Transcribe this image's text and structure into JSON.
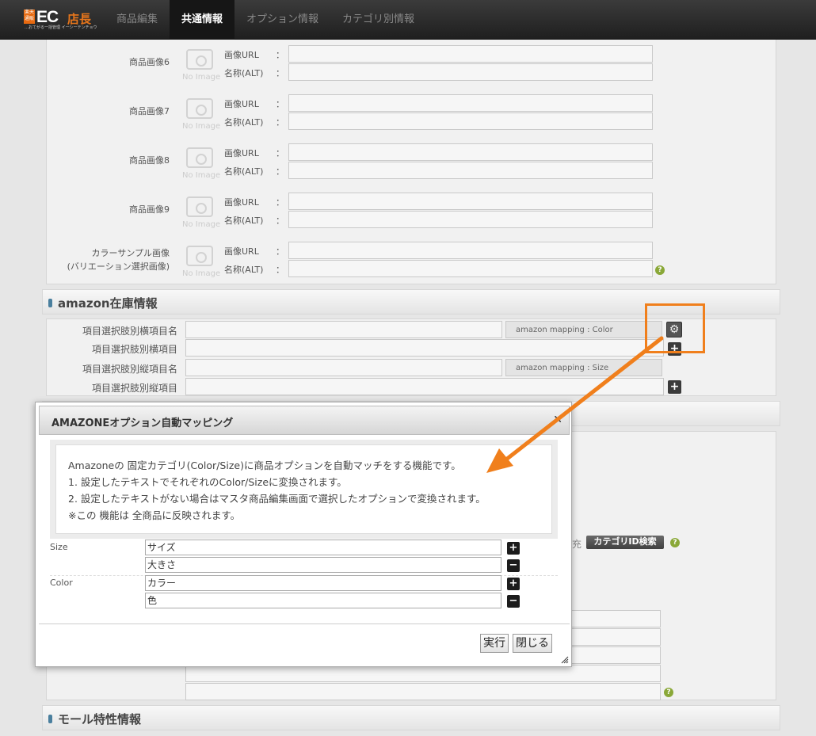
{
  "app": {
    "logo_text_en": "EC",
    "logo_text_jp": "店長",
    "logo_mark": "楽天\n通販",
    "logo_tagline": "…おてがる一括管理 イーシーテンチョウ"
  },
  "nav": {
    "tabs": [
      {
        "label": "商品編集"
      },
      {
        "label": "共通情報"
      },
      {
        "label": "オプション情報"
      },
      {
        "label": "カテゴリ別情報"
      }
    ],
    "active_index": 1
  },
  "images": {
    "rows": [
      {
        "label": "商品画像6"
      },
      {
        "label": "商品画像7"
      },
      {
        "label": "商品画像8"
      },
      {
        "label": "商品画像9"
      },
      {
        "label": "カラーサンプル画像\n(バリエーション選択画像)"
      }
    ],
    "url_label": "画像URL",
    "alt_label": "名称(ALT)",
    "colon": "：",
    "no_image": "No Image",
    "help": "?"
  },
  "amazon_stock": {
    "title": "amazon在庫情報",
    "rows": [
      {
        "label": "項目選択肢別横項目名",
        "mapping": "amazon mapping : Color"
      },
      {
        "label": "項目選択肢別横項目"
      },
      {
        "label": "項目選択肢別縦項目名",
        "mapping": "amazon mapping : Size"
      },
      {
        "label": "項目選択肢別縦項目"
      }
    ]
  },
  "behind": {
    "partial_text": "充",
    "category_search_button": "カテゴリID検索"
  },
  "mall_section": {
    "title": "モール特性情報"
  },
  "modal": {
    "title": "AMAZONEオプション自動マッピング",
    "close_glyph": "✕",
    "description": [
      "Amazoneの 固定カテゴリ(Color/Size)に商品オプションを自動マッチをする機能です。",
      "1. 設定したテキストでそれぞれのColor/Sizeに変換されます。",
      "2. 設定したテキストがない場合はマスタ商品編集画面で選択したオプションで変換されます。",
      "※この 機能は 全商品に反映されます。"
    ],
    "groups": [
      {
        "name": "Size",
        "values": [
          "サイズ",
          "大きさ"
        ]
      },
      {
        "name": "Color",
        "values": [
          "カラー",
          "色"
        ]
      }
    ],
    "plus": "+",
    "minus": "−",
    "execute_label": "実行",
    "close_label": "閉じる"
  },
  "colors": {
    "accent": "#f07f1c",
    "topbar": "#2a2a2a",
    "help": "#8aa838"
  }
}
